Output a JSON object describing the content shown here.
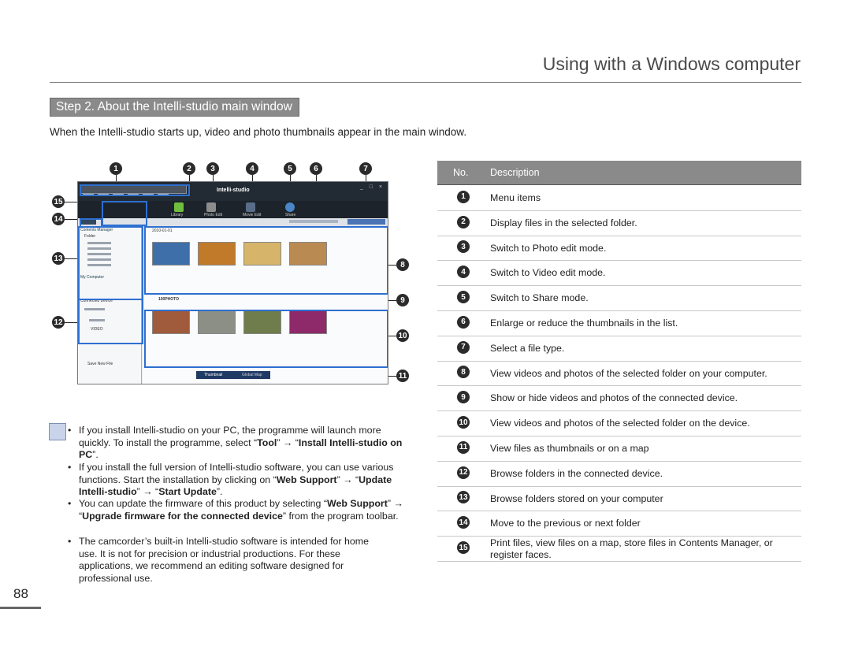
{
  "header": {
    "title": "Using with a Windows computer"
  },
  "step_heading": "Step 2. About the Intelli-studio main window",
  "intro": "When the Intelli-studio starts up, video and photo thumbnails appear in the main window.",
  "callout_numbers": [
    "1",
    "2",
    "3",
    "4",
    "5",
    "6",
    "7",
    "8",
    "9",
    "10",
    "11",
    "12",
    "13",
    "14",
    "15"
  ],
  "screenshot": {
    "logo": "Intelli-studio",
    "toolbar_labels": [
      "Library",
      "Photo Edit",
      "Movie Edit",
      "Share"
    ],
    "left_pane": {
      "contents_manager": "Contents Manager",
      "folder": "Folder",
      "my_computer": "My Computer",
      "connected_device": "Connected Device",
      "video": "VIDEO",
      "save_new_file": "Save New File"
    },
    "main_pane": {
      "date_folder": "2010-01-01",
      "device_folder": "100PHOTO",
      "thumbnail_tab": "Thumbnail",
      "map_tab": "Global Map"
    }
  },
  "table": {
    "headers": {
      "no": "No.",
      "description": "Description"
    },
    "rows": [
      {
        "no": "1",
        "description": "Menu items"
      },
      {
        "no": "2",
        "description": "Display files in the selected folder."
      },
      {
        "no": "3",
        "description": "Switch to Photo edit mode."
      },
      {
        "no": "4",
        "description": "Switch to Video edit mode."
      },
      {
        "no": "5",
        "description": "Switch to Share mode."
      },
      {
        "no": "6",
        "description": "Enlarge or reduce the thumbnails in the list."
      },
      {
        "no": "7",
        "description": "Select a file type."
      },
      {
        "no": "8",
        "description": "View videos and photos of the selected folder on your computer."
      },
      {
        "no": "9",
        "description": "Show or hide videos and photos of the connected device."
      },
      {
        "no": "10",
        "description": "View videos and photos of the selected folder on the device."
      },
      {
        "no": "11",
        "description": "View files as thumbnails or on a map"
      },
      {
        "no": "12",
        "description": "Browse folders in the connected device."
      },
      {
        "no": "13",
        "description": "Browse folders stored on your computer"
      },
      {
        "no": "14",
        "description": "Move to the previous or next folder"
      },
      {
        "no": "15",
        "description": "Print files, view files on a map, store files in Contents Manager, or register faces."
      }
    ]
  },
  "notes": {
    "n1": {
      "a": "If you install Intelli-studio on your PC, the programme will launch more quickly. To install the programme, select “",
      "b1": "Tool",
      "c": "” → “",
      "b2": "Install Intelli-studio on PC",
      "d": "”."
    },
    "n2": {
      "a": "If you install the full version of Intelli-studio software, you can use various functions. Start the installation by clicking on “",
      "b1": "Web Support",
      "c": "” → “",
      "b2": "Update Intelli-studio",
      "d": "” → “",
      "b3": "Start Update",
      "e": "”."
    },
    "n3": {
      "a": "You can update the firmware of this product by selecting “",
      "b1": "Web Support",
      "c": "” → “",
      "b2": "Upgrade firmware for the connected device",
      "d": "” from the program toolbar."
    },
    "n4": {
      "a": "The camcorder’s built-in Intelli-studio software is intended for home use. It is not for precision or industrial productions. For these applications, we recommend an editing software designed for professional use."
    }
  },
  "page_number": "88"
}
